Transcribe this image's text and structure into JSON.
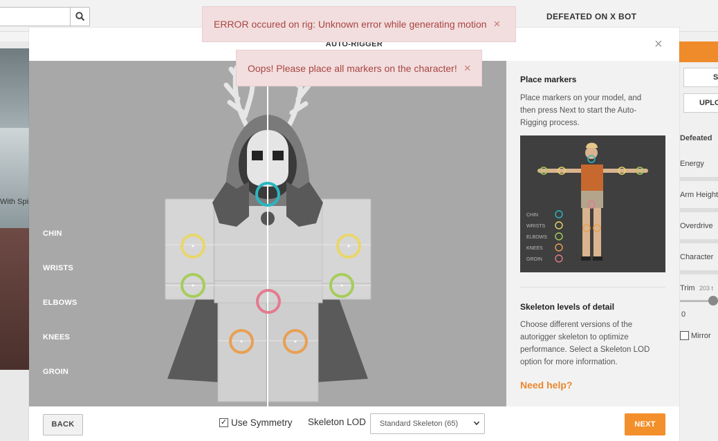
{
  "background": {
    "search_icon": "search-icon",
    "header_title": "DEFEATED ON X BOT",
    "left_label": "With Spin",
    "right_buttons": [
      "S",
      "UPLO"
    ],
    "right_section_title": "Defeated",
    "right_labels": [
      "Energy",
      "Arm Height",
      "Overdrive",
      "Character"
    ],
    "trim_label": "Trim",
    "trim_value": "203 t",
    "trim_zero": "0",
    "mirror_label": "Mirror"
  },
  "toasts": [
    {
      "message": "ERROR occured on rig: Unknown error while generating motion",
      "close": "×"
    },
    {
      "message": "Oops! Please place all markers on the character!",
      "close": "×"
    }
  ],
  "modal": {
    "title": "AUTO-RIGGER",
    "close": "×",
    "marker_labels": [
      "CHIN",
      "WRISTS",
      "ELBOWS",
      "KNEES",
      "GROIN"
    ],
    "marker_colors": {
      "chin": "#2ab7c2",
      "wrists": "#e9d66a",
      "elbows": "#a6cd5a",
      "knees": "#e8a052",
      "groin": "#e47a8d"
    },
    "side": {
      "heading_place": "Place markers",
      "text_place": "Place markers on your model, and then press Next to start the Auto-Rigging process.",
      "ref_legend": [
        "CHIN",
        "WRISTS",
        "ELBOWS",
        "KNEES",
        "GROIN"
      ],
      "heading_lod": "Skeleton levels of detail",
      "text_lod": "Choose different versions of the autorigger skeleton to optimize performance. Select a Skeleton LOD option for more information.",
      "help": "Need help?"
    },
    "footer": {
      "back": "BACK",
      "symmetry_checked": true,
      "symmetry_label": "Use Symmetry",
      "lod_label": "Skeleton LOD",
      "lod_value": "Standard Skeleton (65)",
      "next": "NEXT"
    }
  }
}
